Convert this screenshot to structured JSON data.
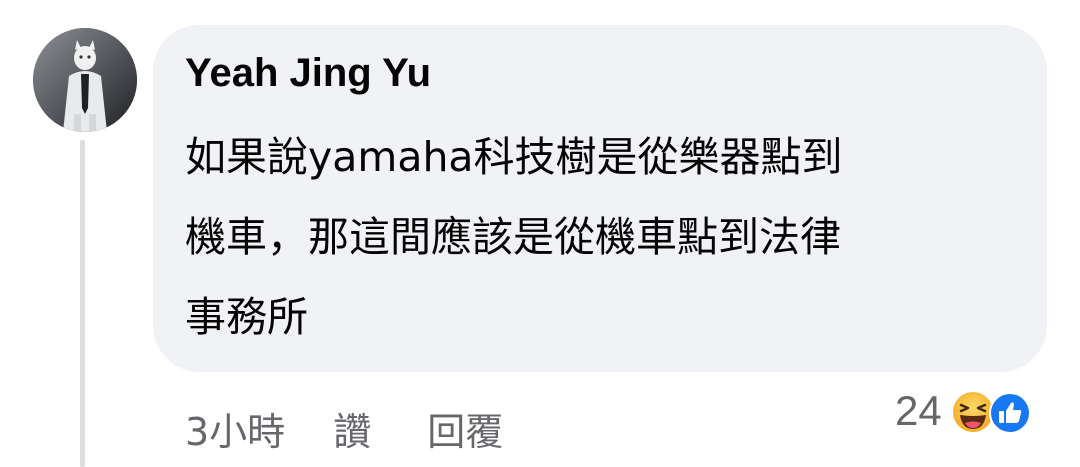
{
  "comment": {
    "author": "Yeah Jing Yu",
    "body_lines": [
      "如果說yamaha科技樹是從樂器點到",
      "機車，那這間應該是從機車點到法律",
      "事務所"
    ],
    "timestamp": "3小時",
    "like_label": "讚",
    "reply_label": "回覆",
    "reaction_count": "24",
    "reaction_icons": [
      "haha-icon",
      "like-icon"
    ]
  },
  "colors": {
    "bubble_bg": "#f0f2f5",
    "text": "#050505",
    "secondary_text": "#65676b",
    "like_blue": "#1877f2",
    "haha_yellow": "#f7b125"
  }
}
